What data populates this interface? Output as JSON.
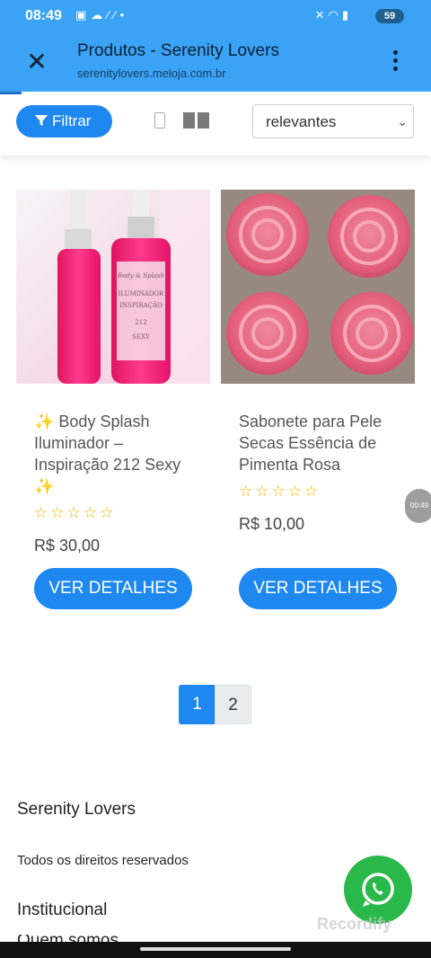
{
  "status_bar": {
    "time": "08:49",
    "battery": "59",
    "left_icons": [
      "screen-record-icon",
      "cloud-icon",
      "sim-icon",
      "dot-icon"
    ],
    "right_icons": [
      "mute-icon",
      "wifi-icon",
      "signal-icon"
    ]
  },
  "app_bar": {
    "title": "Produtos - Serenity Lovers",
    "url": "serenitylovers.meloja.com.br",
    "close_icon": "close-icon",
    "menu_icon": "more-vert-icon"
  },
  "toolbar": {
    "filter_label": "Filtrar",
    "sort_value": "relevantes"
  },
  "products": [
    {
      "name": "✨ Body Splash Iluminador – Inspiração 212 Sexy ✨",
      "rating": 0,
      "price": "R$ 30,00",
      "button": "VER DETALHES",
      "bottle_label_lines": [
        "Body & Splash",
        "ILUMINADOR",
        "INSPIRAÇÃO",
        "212",
        "SEXY"
      ]
    },
    {
      "name": "Sabonete para Pele Secas Essência de Pimenta Rosa",
      "rating": 0,
      "price": "R$ 10,00",
      "button": "VER DETALHES"
    }
  ],
  "pagination": {
    "pages": [
      "1",
      "2"
    ],
    "current": "1"
  },
  "footer": {
    "brand": "Serenity Lovers",
    "rights": "Todos os direitos reservados",
    "section": "Institucional",
    "link_cut": "Quem somos"
  },
  "overlay": {
    "timer": "00:49",
    "watermark": "Recordify"
  },
  "colors": {
    "accent": "#1e88f0",
    "app_bar": "#3aa3f5",
    "whatsapp": "#2bb84a",
    "stars": "#f0b400"
  }
}
